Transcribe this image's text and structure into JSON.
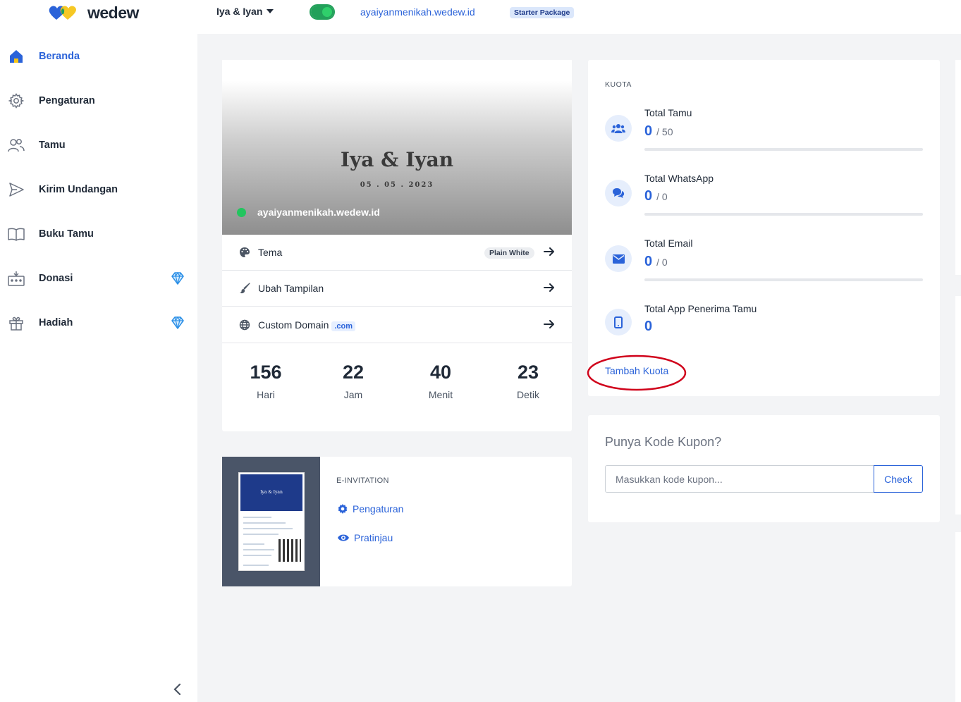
{
  "brand": {
    "name": "wedew"
  },
  "sidebar": {
    "items": [
      {
        "label": "Beranda",
        "icon": "home-icon",
        "active": true
      },
      {
        "label": "Pengaturan",
        "icon": "gear-icon"
      },
      {
        "label": "Tamu",
        "icon": "users-icon"
      },
      {
        "label": "Kirim Undangan",
        "icon": "send-icon"
      },
      {
        "label": "Buku Tamu",
        "icon": "book-icon"
      },
      {
        "label": "Donasi",
        "icon": "donation-icon",
        "premium": true
      },
      {
        "label": "Hadiah",
        "icon": "gift-icon",
        "premium": true
      }
    ]
  },
  "topbar": {
    "couple": "Iya & Iyan",
    "site_url": "ayaiyanmenikah.wedew.id",
    "package": "Starter Package"
  },
  "hero": {
    "names": "Iya & Iyan",
    "date": "05 . 05 . 2023",
    "url": "ayaiyanmenikah.wedew.id"
  },
  "settings_rows": {
    "tema": {
      "label": "Tema",
      "tag": "Plain White"
    },
    "tampilan": {
      "label": "Ubah Tampilan"
    },
    "domain": {
      "label": "Custom Domain",
      "tag": ".com"
    }
  },
  "countdown": [
    {
      "value": "156",
      "label": "Hari"
    },
    {
      "value": "22",
      "label": "Jam"
    },
    {
      "value": "40",
      "label": "Menit"
    },
    {
      "value": "23",
      "label": "Detik"
    }
  ],
  "einvitation": {
    "heading": "E-INVITATION",
    "thumb_title": "Iya & Iyan",
    "links": [
      "Pengaturan",
      "Pratinjau"
    ]
  },
  "quota": {
    "heading": "KUOTA",
    "items": [
      {
        "label": "Total Tamu",
        "value": "0",
        "max": "/ 50",
        "icon": "group-icon",
        "fill": 0
      },
      {
        "label": "Total WhatsApp",
        "value": "0",
        "max": "/ 0",
        "icon": "chat-icon",
        "fill": 0
      },
      {
        "label": "Total Email",
        "value": "0",
        "max": "/ 0",
        "icon": "envelope-icon",
        "fill": 0
      },
      {
        "label": "Total App Penerima Tamu",
        "value": "0",
        "max": "",
        "icon": "mobile-icon"
      }
    ],
    "add_link": "Tambah Kuota"
  },
  "coupon": {
    "title": "Punya Kode Kupon?",
    "placeholder": "Masukkan kode kupon...",
    "button": "Check"
  },
  "colors": {
    "accent": "#2b63d9",
    "success": "#22c55e",
    "annotation": "#d0021b"
  }
}
